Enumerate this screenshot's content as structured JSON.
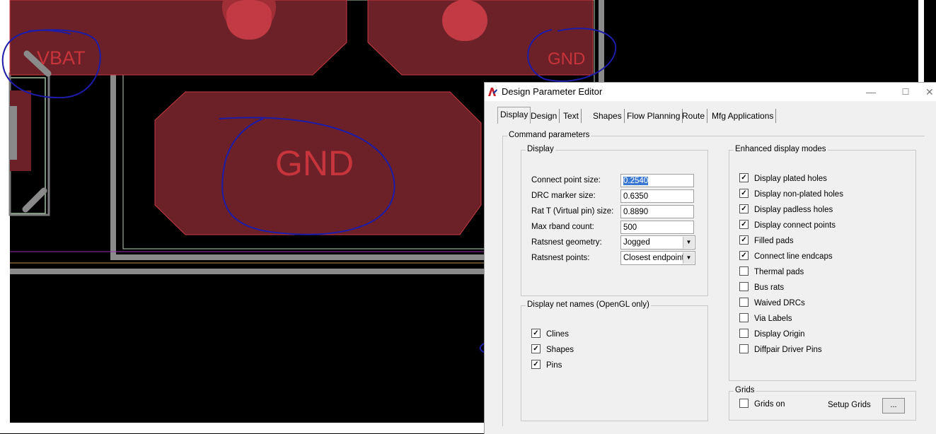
{
  "canvas": {
    "labels": {
      "vbat": "VBAT",
      "gnd_small": "GND",
      "gnd_large": "GND"
    },
    "colors": {
      "pad": "#6b2127",
      "pad_text": "#c8343c",
      "annotation": "#1c1ca8",
      "outline": "#8a8a8a"
    }
  },
  "dialog": {
    "title": "Design Parameter Editor",
    "window_buttons": {
      "minimize": "—",
      "maximize": "☐",
      "close": "✕"
    },
    "tabs": [
      "Display",
      "Design",
      "Text",
      "Shapes",
      "Flow Planning",
      "Route",
      "Mfg Applications"
    ],
    "active_tab": "Display",
    "command_parameters": {
      "label": "Command parameters",
      "display": {
        "label": "Display",
        "fields": [
          {
            "label": "Connect point size:",
            "value": "0.2540"
          },
          {
            "label": "DRC marker size:",
            "value": "0.6350"
          },
          {
            "label": "Rat T (Virtual pin) size:",
            "value": "0.8890"
          },
          {
            "label": "Max rband count:",
            "value": "500"
          }
        ],
        "combos": [
          {
            "label": "Ratsnest geometry:",
            "value": "Jogged"
          },
          {
            "label": "Ratsnest points:",
            "value": "Closest endpoint"
          }
        ]
      },
      "net_names": {
        "label": "Display net names (OpenGL only)",
        "items": [
          {
            "label": "Clines",
            "checked": true
          },
          {
            "label": "Shapes",
            "checked": true
          },
          {
            "label": "Pins",
            "checked": true
          }
        ]
      },
      "enhanced": {
        "label": "Enhanced display modes",
        "items": [
          {
            "label": "Display plated holes",
            "checked": true
          },
          {
            "label": "Display non-plated holes",
            "checked": true
          },
          {
            "label": "Display padless holes",
            "checked": true
          },
          {
            "label": "Display connect points",
            "checked": true
          },
          {
            "label": "Filled pads",
            "checked": true
          },
          {
            "label": "Connect line endcaps",
            "checked": true
          },
          {
            "label": "Thermal pads",
            "checked": false
          },
          {
            "label": "Bus rats",
            "checked": false
          },
          {
            "label": "Waived DRCs",
            "checked": false
          },
          {
            "label": "Via Labels",
            "checked": false
          },
          {
            "label": "Display Origin",
            "checked": false
          },
          {
            "label": "Diffpair Driver Pins",
            "checked": false
          }
        ]
      },
      "grids": {
        "label": "Grids",
        "grids_on_label": "Grids on",
        "grids_on_checked": false,
        "setup_label": "Setup Grids",
        "setup_button": "..."
      }
    }
  }
}
